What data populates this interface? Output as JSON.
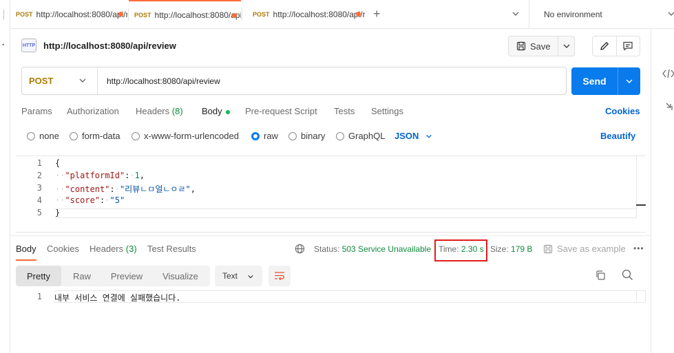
{
  "tabs": [
    {
      "method": "POST",
      "url": "http://localhost:8080/api/review"
    },
    {
      "method": "POST",
      "url": "http://localhost:8080/api/review"
    },
    {
      "method": "POST",
      "url": "http://localhost:8080/api/review"
    }
  ],
  "environment": "No environment",
  "request": {
    "name": "http://localhost:8080/api/review",
    "icon_text": "HTTP",
    "save_label": "Save",
    "method": "POST",
    "url": "http://localhost:8080/api/review",
    "send_label": "Send"
  },
  "request_tabs": {
    "params": "Params",
    "authorization": "Authorization",
    "headers": "Headers",
    "headers_count": "(8)",
    "body": "Body",
    "pre_request": "Pre-request Script",
    "tests": "Tests",
    "settings": "Settings",
    "cookies": "Cookies"
  },
  "body_types": {
    "none": "none",
    "form_data": "form-data",
    "urlencoded": "x-www-form-urlencoded",
    "raw": "raw",
    "binary": "binary",
    "graphql": "GraphQL",
    "selected": "raw",
    "language": "JSON",
    "beautify": "Beautify"
  },
  "request_body": {
    "line_numbers": [
      "1",
      "2",
      "3",
      "4",
      "5"
    ],
    "open_brace": "{",
    "close_brace": "}",
    "fields": [
      {
        "key": "\"platformId\"",
        "value": "1",
        "type": "number",
        "comma": ","
      },
      {
        "key": "\"content\"",
        "value": "\"리뷰ㄴㅁ얼ㄴㅇㄹ\"",
        "type": "string",
        "comma": ","
      },
      {
        "key": "\"score\"",
        "value": "\"5\"",
        "type": "string",
        "comma": ""
      }
    ]
  },
  "response": {
    "tabs": {
      "body": "Body",
      "cookies": "Cookies",
      "headers": "Headers",
      "headers_count": "(3)",
      "test_results": "Test Results"
    },
    "status_label": "Status:",
    "status_value": "503 Service Unavailable",
    "time_label": "Time:",
    "time_value": "2.30 s",
    "size_label": "Size:",
    "size_value": "179 B",
    "save_example": "Save as example",
    "view_tabs": {
      "pretty": "Pretty",
      "raw": "Raw",
      "preview": "Preview",
      "visualize": "Visualize"
    },
    "format": "Text",
    "line_number": "1",
    "body_text": "내부 서비스 연결에 실패했습니다."
  },
  "colors": {
    "accent": "#ff6c37",
    "send_blue": "#097bed",
    "link_blue": "#0265d2",
    "status_green": "#0f8a3d",
    "highlight_red": "#e01b1b",
    "post_method": "#ad7a03"
  }
}
